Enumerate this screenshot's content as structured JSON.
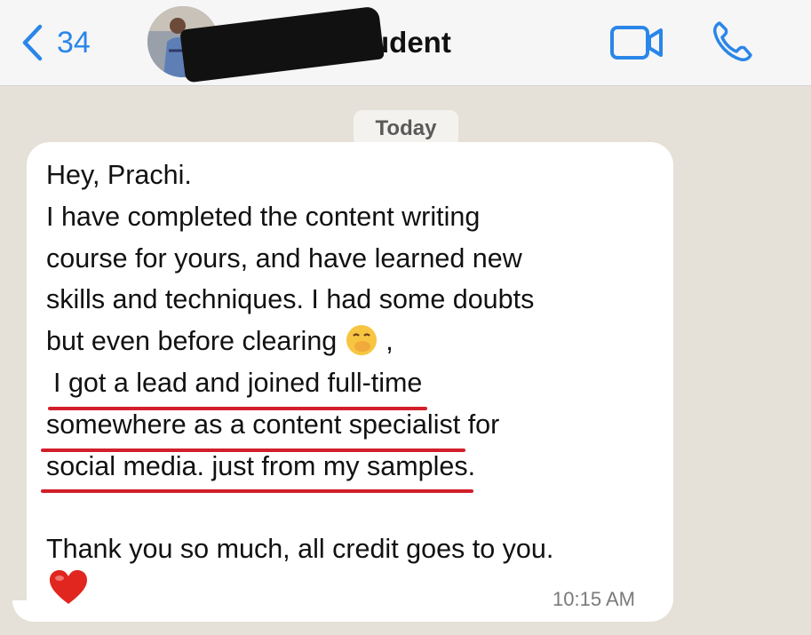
{
  "header": {
    "back_count": "34",
    "contact_name_visible": "udent"
  },
  "chat": {
    "date_chip": "Today",
    "message": {
      "lines": [
        "Hey, Prachi.",
        "I have completed the content writing",
        "course for yours, and have learned new",
        "skills and techniques. I had some doubts",
        "but even before clearing",
        ",",
        "I got a lead and joined full-time",
        "somewhere as a content specialist",
        "for",
        "social media. just from my samples",
        ".",
        "Thank you so much, all credit goes to you."
      ],
      "time": "10:15 AM"
    }
  },
  "colors": {
    "accent": "#2a86e8",
    "underline": "#d21f2b",
    "header_bg": "#f6f6f6",
    "chat_bg": "#e6e1d8"
  },
  "icons": {
    "back": "chevron-left-icon",
    "video": "video-camera-icon",
    "phone": "phone-icon",
    "emoji": "face-with-hand-over-mouth-emoji",
    "heart": "red-heart-emoji"
  }
}
